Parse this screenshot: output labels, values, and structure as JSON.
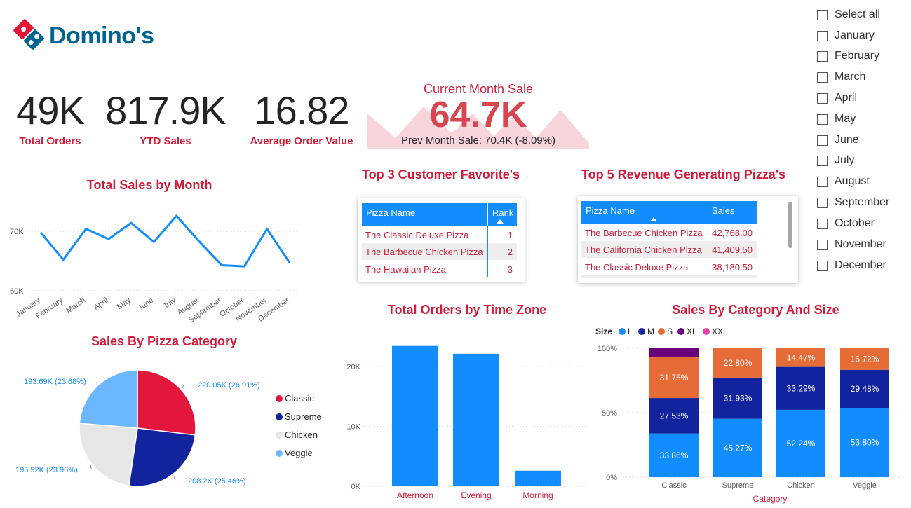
{
  "brand": {
    "name": "Domino's",
    "colors": {
      "accent": "#d21c3a",
      "blue": "#118dff",
      "logo_blue": "#006491"
    }
  },
  "kpis": [
    {
      "value": "49K",
      "label": "Total Orders"
    },
    {
      "value": "817.9K",
      "label": "YTD Sales"
    },
    {
      "value": "16.82",
      "label": "Average Order Value"
    }
  ],
  "current_month": {
    "title": "Current Month Sale",
    "value": "64.7K",
    "prev": "Prev Month Sale: 70.4K (-8.09%)"
  },
  "month_filter": {
    "items": [
      "Select all",
      "January",
      "February",
      "March",
      "April",
      "May",
      "June",
      "July",
      "August",
      "September",
      "October",
      "November",
      "December"
    ]
  },
  "top3": {
    "title": "Top 3 Customer Favorite's",
    "columns": [
      "Pizza Name",
      "Rank"
    ],
    "rows": [
      {
        "name": "The Classic Deluxe Pizza",
        "rank": "1"
      },
      {
        "name": "The Barbecue Chicken Pizza",
        "rank": "2"
      },
      {
        "name": "The Hawaiian Pizza",
        "rank": "3"
      }
    ]
  },
  "top5": {
    "title": "Top 5 Revenue Generating Pizza's",
    "columns": [
      "Pizza Name",
      "Sales"
    ],
    "rows": [
      {
        "name": "The Barbecue Chicken Pizza",
        "sales": "42,768.00"
      },
      {
        "name": "The California Chicken Pizza",
        "sales": "41,409.50"
      },
      {
        "name": "The Classic Deluxe Pizza",
        "sales": "38,180.50"
      }
    ]
  },
  "chart_data": [
    {
      "type": "line",
      "title": "Total Sales by Month",
      "categories": [
        "January",
        "February",
        "March",
        "April",
        "May",
        "June",
        "July",
        "August",
        "September",
        "October",
        "November",
        "December"
      ],
      "values": [
        69.8,
        65.2,
        70.4,
        68.7,
        71.4,
        68.2,
        72.6,
        68.3,
        64.3,
        64.1,
        70.4,
        64.7
      ],
      "ylim": [
        60,
        75
      ],
      "ytick_labels": [
        "70K",
        "60K"
      ],
      "color": "#118dff"
    },
    {
      "type": "pie",
      "title": "Sales By Pizza Category",
      "slices": [
        {
          "name": "Classic",
          "value": 220.05,
          "label": "220.05K (26.91%)",
          "color": "#e3173e"
        },
        {
          "name": "Supreme",
          "value": 208.2,
          "label": "208.2K (25.46%)",
          "color": "#12239e"
        },
        {
          "name": "Chicken",
          "value": 195.92,
          "label": "195.92K (23.96%)",
          "color": "#e6e6e6"
        },
        {
          "name": "Veggie",
          "value": 193.69,
          "label": "193.69K (23.68%)",
          "color": "#6cb8ff"
        }
      ]
    },
    {
      "type": "bar",
      "title": "Total Orders by Time Zone",
      "categories": [
        "Afternoon",
        "Evening",
        "Morning"
      ],
      "values": [
        23400,
        22100,
        2600
      ],
      "ylim": [
        0,
        25000
      ],
      "ytick_labels": [
        "20K",
        "10K",
        "0K"
      ],
      "color": "#118dff"
    },
    {
      "type": "bar",
      "title": "Sales By Category And Size",
      "xlabel": "Category",
      "legend_title": "Size",
      "legend": [
        {
          "name": "L",
          "color": "#118dff"
        },
        {
          "name": "M",
          "color": "#12239e"
        },
        {
          "name": "S",
          "color": "#e66c37"
        },
        {
          "name": "XL",
          "color": "#6b007b"
        },
        {
          "name": "XXL",
          "color": "#e044a7"
        }
      ],
      "categories": [
        "Classic",
        "Supreme",
        "Chicken",
        "Veggie"
      ],
      "series": [
        {
          "name": "L",
          "values": [
            33.86,
            45.27,
            52.24,
            53.8
          ],
          "labels": [
            "33.86%",
            "45.27%",
            "52.24%",
            "53.80%"
          ]
        },
        {
          "name": "M",
          "values": [
            27.53,
            31.93,
            33.29,
            29.48
          ],
          "labels": [
            "27.53%",
            "31.93%",
            "33.29%",
            "29.48%"
          ]
        },
        {
          "name": "S",
          "values": [
            31.75,
            22.8,
            14.47,
            16.72
          ],
          "labels": [
            "31.75%",
            "22.80%",
            "14.47%",
            "16.72%"
          ]
        },
        {
          "name": "XL",
          "values": [
            6.86,
            0,
            0,
            0
          ],
          "labels": [
            "",
            "",
            "",
            ""
          ]
        }
      ],
      "ytick_labels": [
        "100%",
        "50%",
        "0%"
      ]
    }
  ]
}
